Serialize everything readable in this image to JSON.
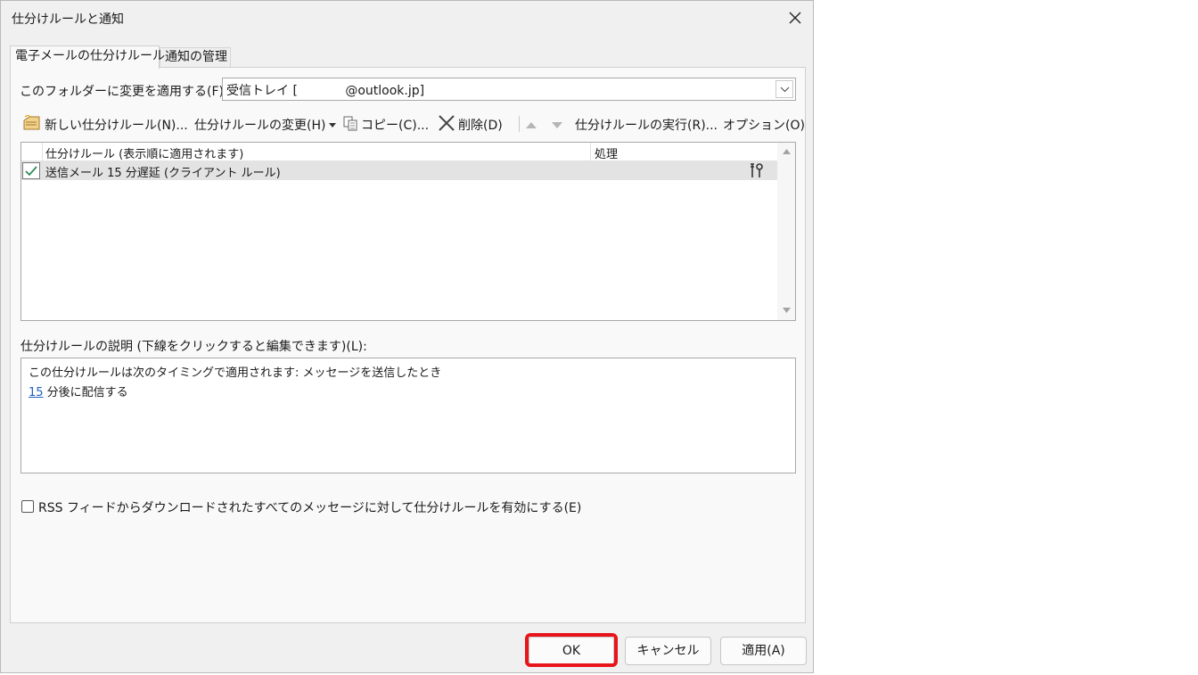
{
  "dialog": {
    "title": "仕分けルールと通知",
    "tabs": [
      {
        "label": "電子メールの仕分けルール",
        "active": true
      },
      {
        "label": "通知の管理",
        "active": false
      }
    ],
    "folder": {
      "label": "このフォルダーに変更を適用する(F):",
      "value": "受信トレイ [            @outlook.jp]"
    },
    "toolbar": {
      "new_rule": "新しい仕分けルール(N)...",
      "change_rule": "仕分けルールの変更(H)",
      "copy": "コピー(C)...",
      "delete": "削除(D)",
      "run_rules": "仕分けルールの実行(R)...",
      "options": "オプション(O)"
    },
    "rules_table": {
      "columns": [
        "仕分けルール (表示順に適用されます)",
        "処理"
      ],
      "rows": [
        {
          "name": "送信メール 15 分遅延 (クライアント ルール)",
          "checked": true
        }
      ]
    },
    "description": {
      "label": "仕分けルールの説明 (下線をクリックすると編集できます)(L):",
      "line1": "この仕分けルールは次のタイミングで適用されます: メッセージを送信したとき",
      "line2_link": "15",
      "line2_text": " 分後に配信する"
    },
    "rss": {
      "label": "RSS フィードからダウンロードされたすべてのメッセージに対して仕分けルールを有効にする(E)",
      "checked": false
    },
    "buttons": {
      "ok": "OK",
      "cancel": "キャンセル",
      "apply": "適用(A)"
    },
    "colors": {
      "highlight": "#e8141b",
      "link": "#1f5fbf",
      "selected_row": "#e3e3e3",
      "check_green": "#2e8b57"
    }
  }
}
